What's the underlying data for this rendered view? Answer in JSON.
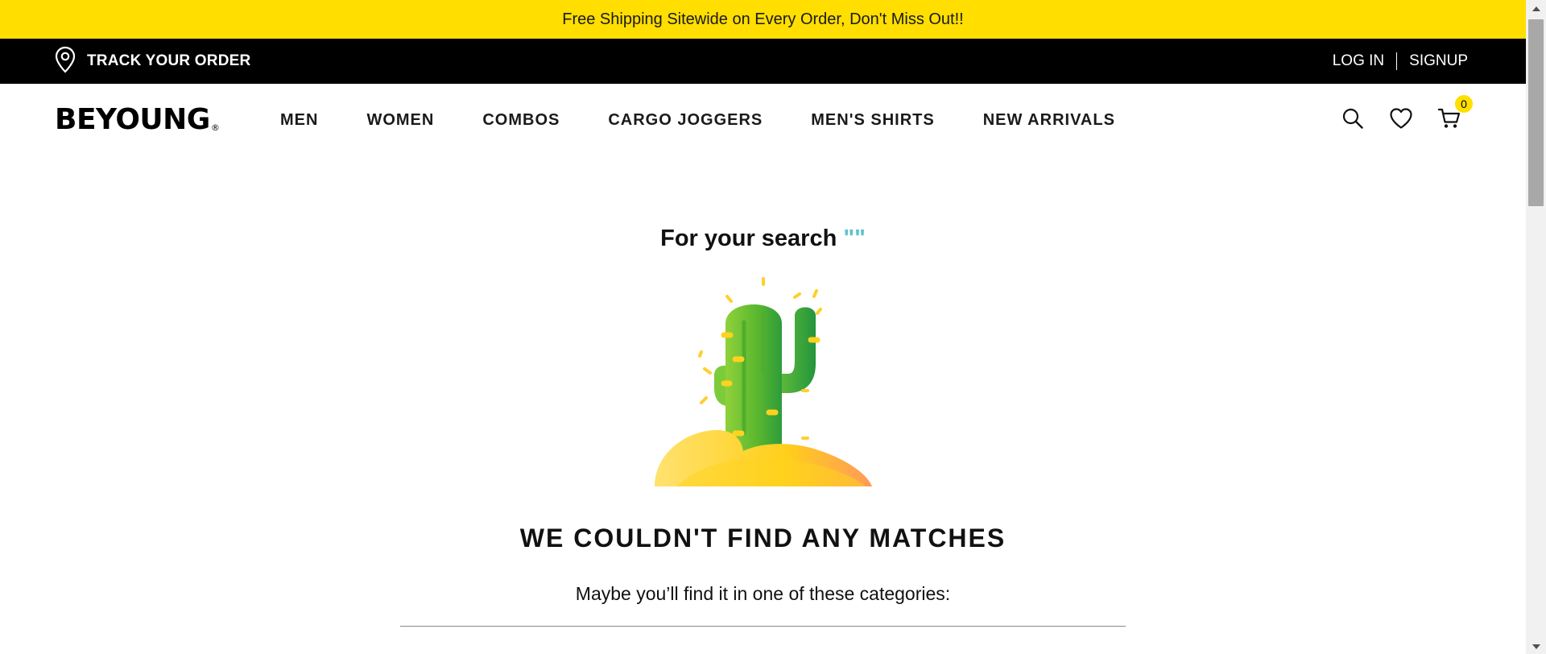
{
  "promo": {
    "text": "Free Shipping Sitewide on Every Order, Don't Miss Out!!"
  },
  "utility": {
    "track_label": "TRACK YOUR ORDER",
    "login_label": "LOG IN",
    "signup_label": "SIGNUP"
  },
  "header": {
    "logo_text": "BEYOUNG",
    "logo_mark": "®",
    "nav": [
      {
        "label": "MEN"
      },
      {
        "label": "WOMEN"
      },
      {
        "label": "COMBOS"
      },
      {
        "label": "CARGO JOGGERS"
      },
      {
        "label": "MEN'S SHIRTS"
      },
      {
        "label": "NEW ARRIVALS"
      }
    ],
    "icons": [
      "search-icon",
      "heart-icon",
      "cart-icon"
    ],
    "cart_count": "0"
  },
  "results": {
    "heading_prefix": "For your search",
    "query_display": "\"\"",
    "illustration": "cactus-illustration",
    "no_match_text": "WE COULDN'T FIND ANY MATCHES",
    "suggestion_text": "Maybe you’ll find it in one of these categories:"
  },
  "colors": {
    "promo_bg": "#ffde00",
    "utility_bg": "#000000",
    "query_accent": "#5ec3cc",
    "badge_bg": "#ffde00"
  }
}
